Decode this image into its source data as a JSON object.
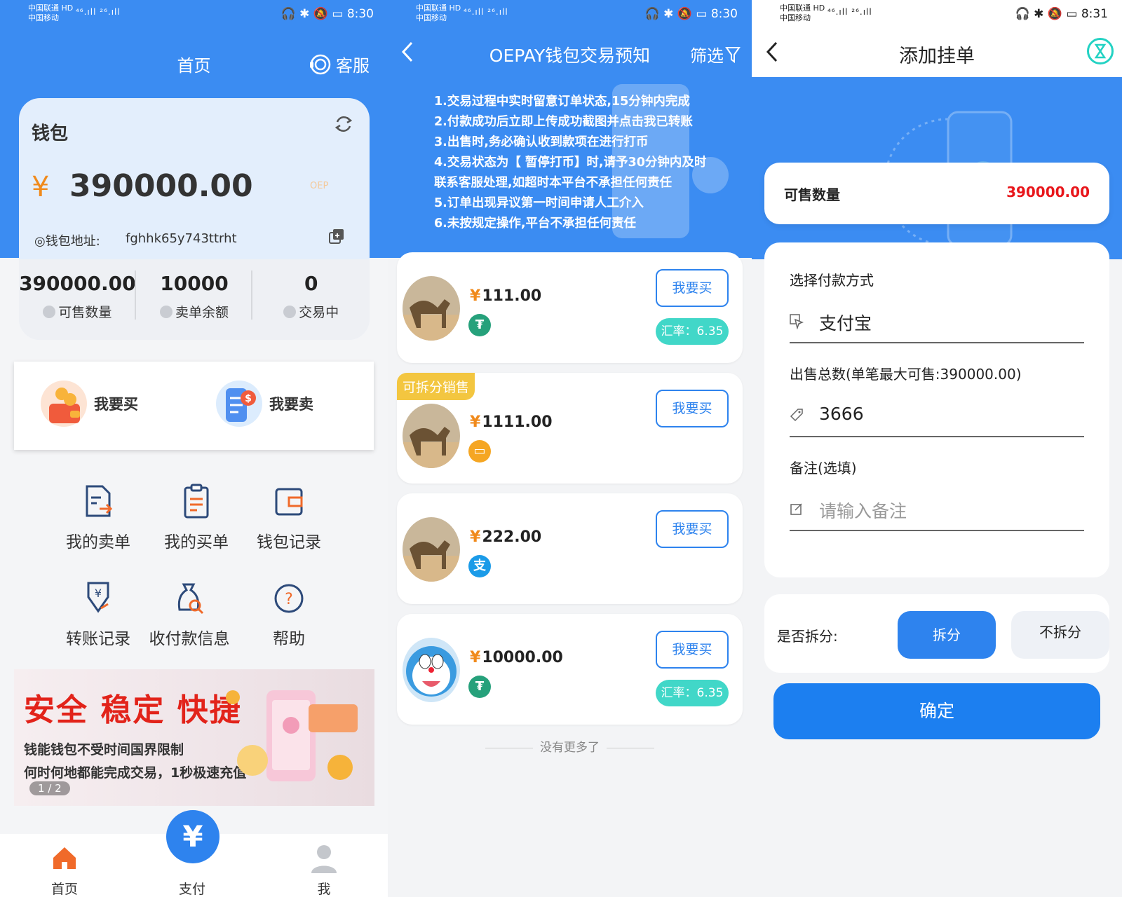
{
  "status_bar": {
    "carrier_1": "中国联通",
    "carrier_2": "中国移动",
    "hd": "HD",
    "signal": "⁴⁶.ıll ²⁶.ıll",
    "times": [
      "8:30",
      "8:30",
      "8:31"
    ]
  },
  "screen1": {
    "title": "首页",
    "customer_service": "客服",
    "wallet": {
      "title": "钱包",
      "currency_symbol": "¥",
      "balance": "390000.00",
      "unit": "OEP",
      "address_label": "钱包地址:",
      "address": "fghhk65y743ttrht"
    },
    "stats": [
      {
        "value": "390000.00",
        "label": "可售数量"
      },
      {
        "value": "10000",
        "label": "卖单余额"
      },
      {
        "value": "0",
        "label": "交易中"
      }
    ],
    "actions": {
      "buy": "我要买",
      "sell": "我要卖"
    },
    "grid": [
      {
        "label": "我的卖单",
        "icon": "sell-order-icon"
      },
      {
        "label": "我的买单",
        "icon": "buy-order-icon"
      },
      {
        "label": "钱包记录",
        "icon": "wallet-record-icon"
      },
      {
        "label": "转账记录",
        "icon": "transfer-record-icon"
      },
      {
        "label": "收付款信息",
        "icon": "payment-info-icon"
      },
      {
        "label": "帮助",
        "icon": "help-icon"
      }
    ],
    "banner": {
      "headline": "安全 稳定 快捷",
      "line1": "钱能钱包不受时间国界限制",
      "line2": "何时何地都能完成交易，1秒极速充值",
      "pager": "1 / 2"
    },
    "tabbar": {
      "home": "首页",
      "pay": "支付",
      "pay_symbol": "¥",
      "me": "我"
    },
    "accent": "#3b8cf2"
  },
  "screen2": {
    "title": "OEPAY钱包交易预知",
    "filter": "筛选",
    "rules": [
      "1.交易过程中实时留意订单状态,15分钟内完成",
      "2.付款成功后立即上传成功截图并点击我已转账",
      "3.出售时,务必确认收到款项在进行打币",
      "4.交易状态为【 暂停打币】时,请予30分钟内及时",
      "联系客服处理,如超时本平台不承担任何责任",
      "5.订单出现异议第一时间申请人工介入",
      "6.未按规定操作,平台不承担任何责任"
    ],
    "orders": [
      {
        "price": "111.00",
        "pay_icon": "tether-icon",
        "pay_color": "#26a17b",
        "buy": "我要买",
        "rate": "汇率：6.35",
        "tag": ""
      },
      {
        "price": "1111.00",
        "pay_icon": "bank-card-icon",
        "pay_color": "#f5a623",
        "buy": "我要买",
        "rate": "",
        "tag": "可拆分销售"
      },
      {
        "price": "222.00",
        "pay_icon": "alipay-icon",
        "pay_color": "#1b9be8",
        "buy": "我要买",
        "rate": "",
        "tag": ""
      },
      {
        "price": "10000.00",
        "pay_icon": "tether-icon",
        "pay_color": "#26a17b",
        "buy": "我要买",
        "rate": "汇率：6.35",
        "tag": ""
      }
    ],
    "currency_symbol": "¥",
    "no_more": "没有更多了"
  },
  "screen3": {
    "title": "添加挂单",
    "sellable_label": "可售数量",
    "sellable_value": "390000.00",
    "payment_label": "选择付款方式",
    "payment_value": "支付宝",
    "total_label": "出售总数(单笔最大可售:390000.00)",
    "total_value": "3666",
    "remark_label": "备注(选填)",
    "remark_placeholder": "请输入备注",
    "split_label": "是否拆分:",
    "split_yes": "拆分",
    "split_no": "不拆分",
    "confirm": "确定"
  }
}
